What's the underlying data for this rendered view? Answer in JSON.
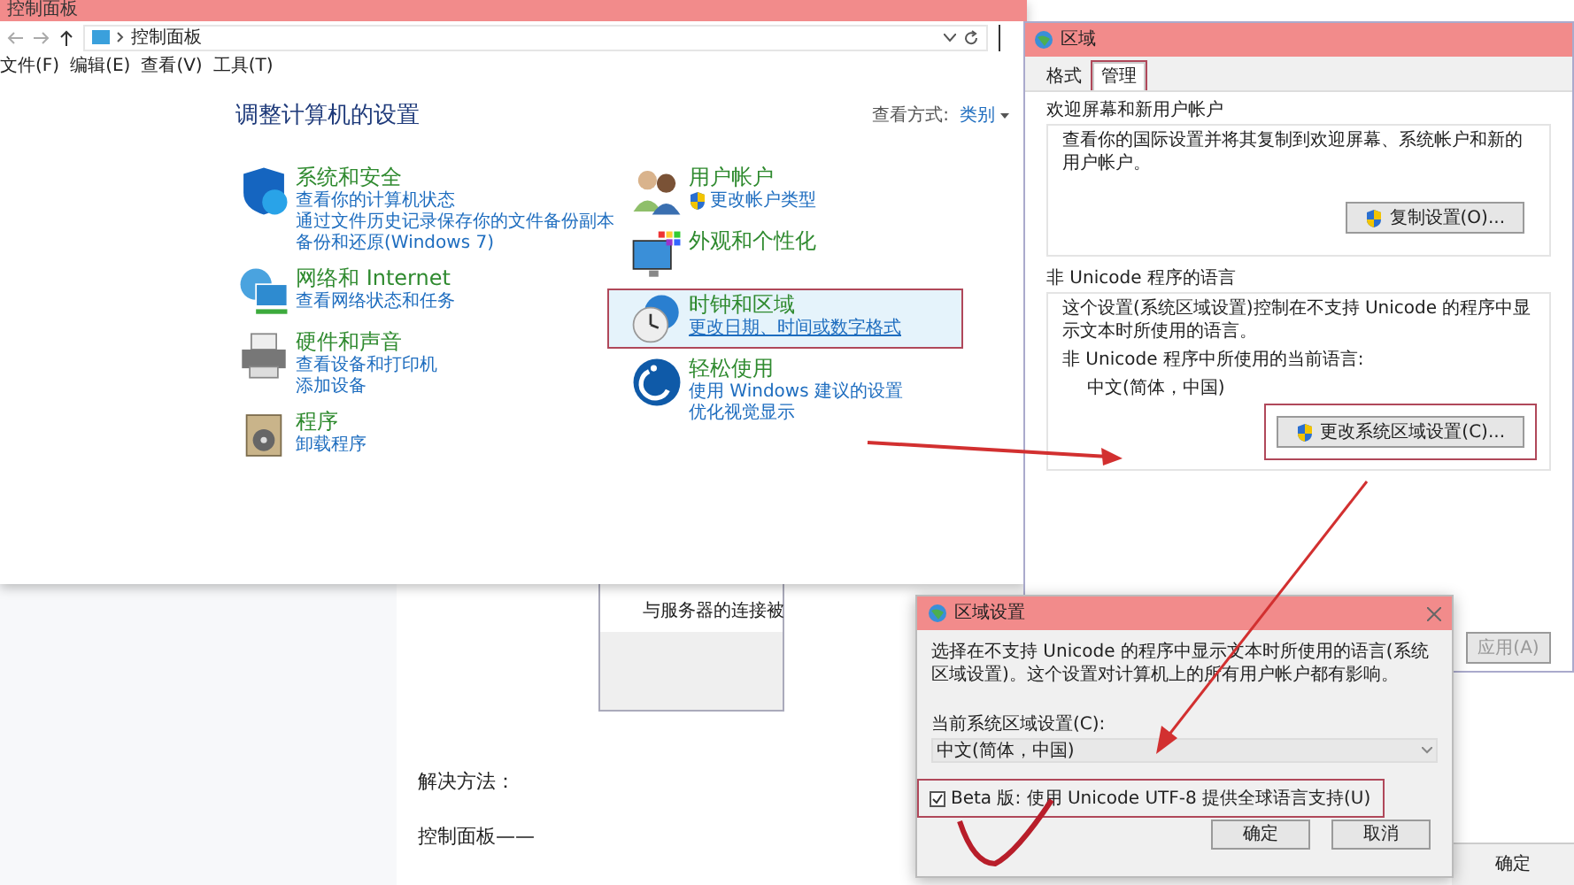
{
  "control_panel": {
    "title": "控制面板",
    "breadcrumb": "控制面板",
    "menu": [
      "文件(F)",
      "编辑(E)",
      "查看(V)",
      "工具(T)"
    ],
    "heading": "调整计算机的设置",
    "view_label": "查看方式:",
    "view_value": "类别",
    "columns": [
      [
        {
          "kind": "shield",
          "title": "系统和安全",
          "selected": false,
          "links": [
            "查看你的计算机状态",
            "通过文件历史记录保存你的文件备份副本",
            "备份和还原(Windows 7)"
          ]
        },
        {
          "kind": "network",
          "title": "网络和 Internet",
          "selected": false,
          "links": [
            "查看网络状态和任务"
          ]
        },
        {
          "kind": "printer",
          "title": "硬件和声音",
          "selected": false,
          "links": [
            "查看设备和打印机",
            "添加设备"
          ]
        },
        {
          "kind": "program",
          "title": "程序",
          "selected": false,
          "links": [
            "卸载程序"
          ]
        }
      ],
      [
        {
          "kind": "users",
          "title": "用户帐户",
          "selected": false,
          "links": [
            "更改帐户类型"
          ]
        },
        {
          "kind": "appearance",
          "title": "外观和个性化",
          "selected": false
        },
        {
          "kind": "clock",
          "title": "时钟和区域",
          "selected": true,
          "links": [
            "更改日期、时间或数字格式"
          ]
        },
        {
          "kind": "ease",
          "title": "轻松使用",
          "selected": false,
          "links": [
            "使用 Windows 建议的设置",
            "优化视觉显示"
          ]
        }
      ]
    ]
  },
  "background_doc": {
    "clipped_text": "与服务器的连接被",
    "paragraphs": [
      "解决方法：",
      "控制面板——"
    ],
    "button": "确定"
  },
  "region_dialog": {
    "title": "区域",
    "tabs": [
      {
        "label": "格式",
        "selected": false,
        "highlighted": false
      },
      {
        "label": "管理",
        "selected": true,
        "highlighted": true
      }
    ],
    "groups": [
      {
        "title": "欢迎屏幕和新用户帐户",
        "lines": [
          "查看你的国际设置并将其复制到欢迎屏幕、系统帐户和新的用户帐户。"
        ],
        "button": "复制设置(O)...",
        "highlighted": false
      },
      {
        "title": "非 Unicode 程序的语言",
        "lines": [
          "这个设置(系统区域设置)控制在不支持 Unicode 的程序中显示文本时所使用的语言。",
          "非 Unicode 程序中所使用的当前语言:",
          "中文(简体，中国)"
        ],
        "button": "更改系统区域设置(C)...",
        "highlighted": true
      }
    ],
    "apply_button": "应用(A)"
  },
  "locale_dialog": {
    "title": "区域设置",
    "description": "选择在不支持 Unicode 的程序中显示文本时所使用的语言(系统区域设置)。这个设置对计算机上的所有用户帐户都有影响。",
    "select_label": "当前系统区域设置(C):",
    "select_value": "中文(简体，中国)",
    "checkbox": {
      "label": "Beta 版: 使用 Unicode UTF-8 提供全球语言支持(U)",
      "checked": true,
      "highlighted": true
    },
    "buttons": [
      "确定",
      "取消"
    ]
  }
}
